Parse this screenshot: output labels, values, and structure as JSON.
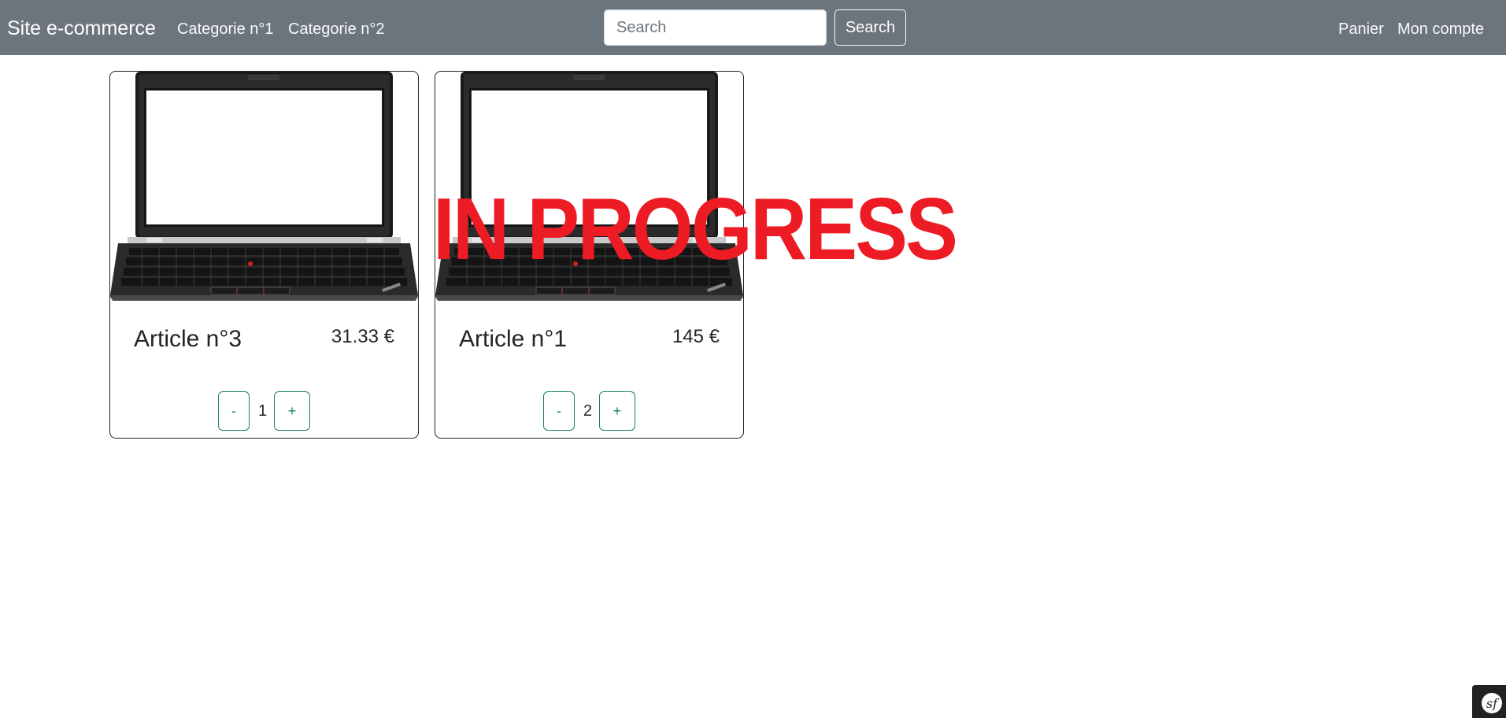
{
  "navbar": {
    "brand": "Site e-commerce",
    "links": [
      "Categorie n°1",
      "Categorie n°2"
    ],
    "search": {
      "placeholder": "Search",
      "value": "",
      "button_label": "Search"
    },
    "right_links": [
      "Panier",
      "Mon compte"
    ],
    "background_color": "#6c757d"
  },
  "products": [
    {
      "title": "Article n°3",
      "price": "31.33 €",
      "minus_label": "-",
      "quantity": "1",
      "plus_label": "+",
      "image_icon": "laptop-icon"
    },
    {
      "title": "Article n°1",
      "price": "145 €",
      "minus_label": "-",
      "quantity": "2",
      "plus_label": "+",
      "image_icon": "laptop-icon"
    }
  ],
  "overlay": {
    "text": "IN PROGRESS",
    "color": "#ed1c24"
  },
  "debug_toolbar": {
    "icon": "symfony-icon"
  },
  "colors": {
    "accent_green": "#198754"
  }
}
